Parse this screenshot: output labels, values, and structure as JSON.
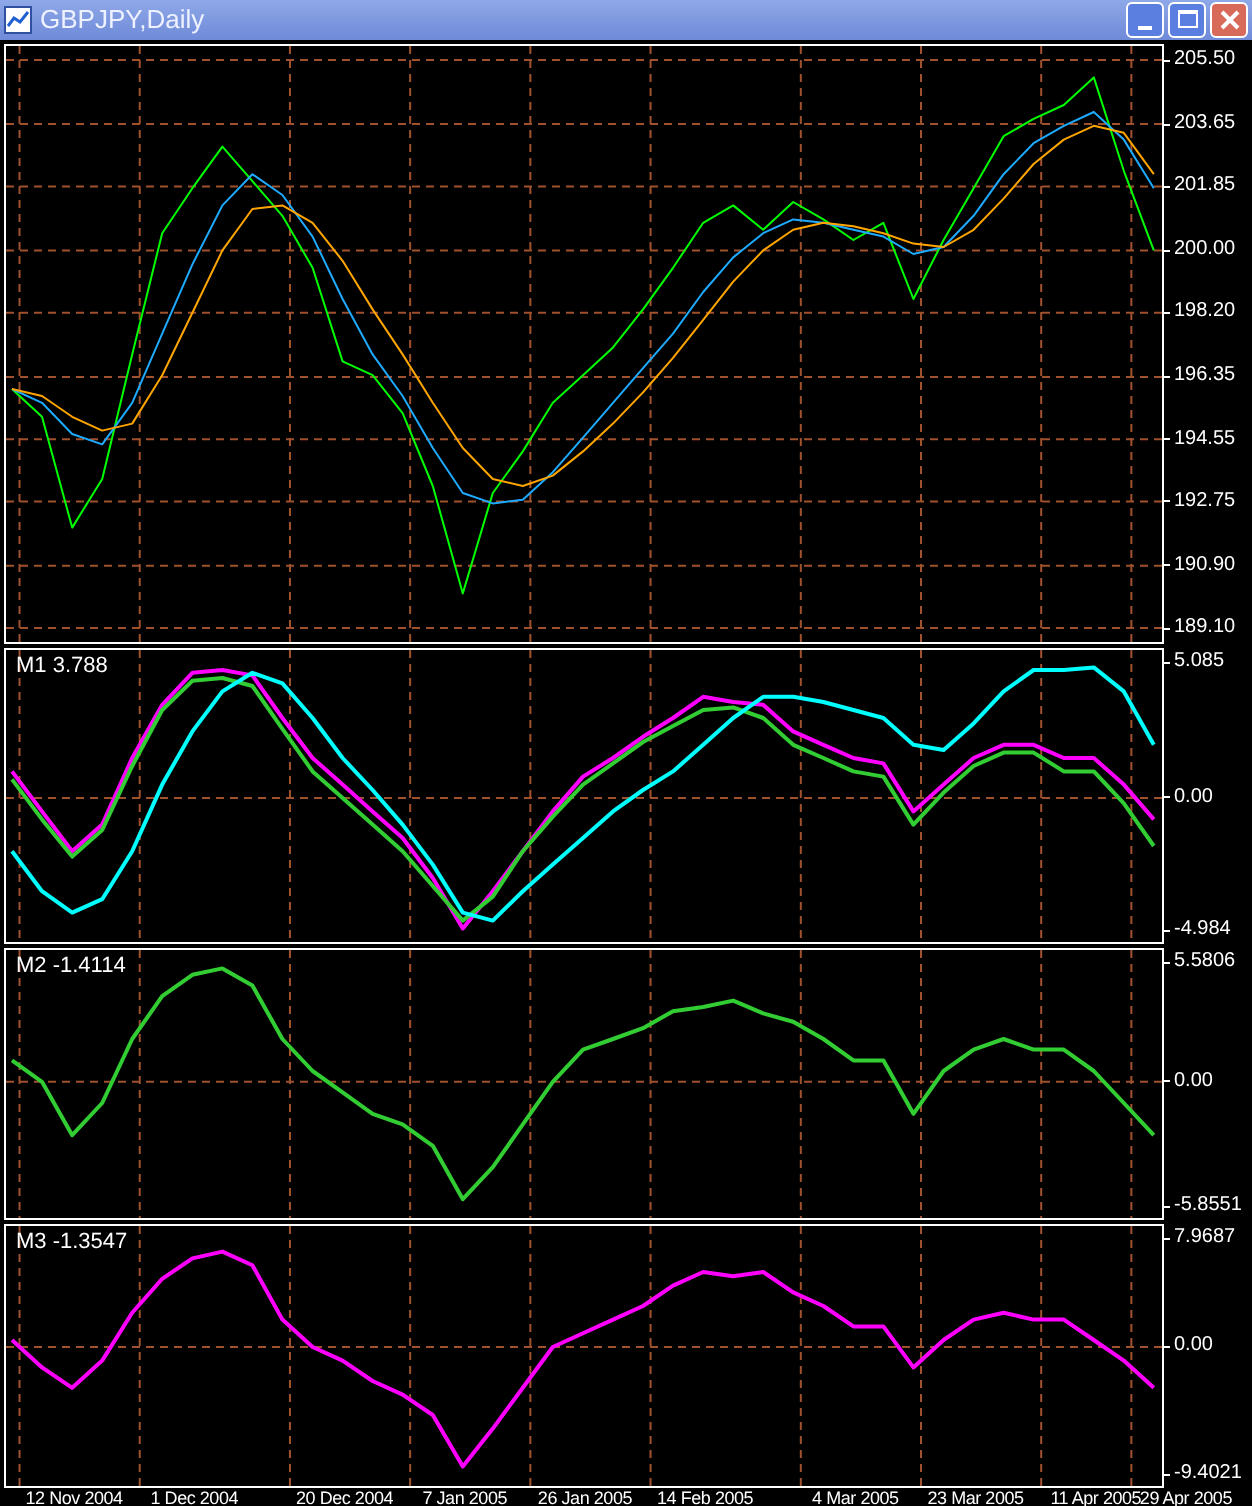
{
  "window": {
    "title": "GBPJPY,Daily"
  },
  "charts": [
    {
      "chart_data": {
        "type": "line",
        "grid": true,
        "ylim": [
          189.1,
          205.5
        ],
        "categories": [
          null,
          null,
          null,
          null,
          null,
          null,
          null,
          null,
          null,
          null,
          null,
          null,
          null,
          null,
          null,
          null,
          null,
          null,
          null,
          null,
          null,
          null,
          null,
          null,
          null,
          null,
          null,
          null,
          null,
          null,
          null,
          null,
          null,
          null,
          null,
          null,
          null,
          null,
          null,
          null,
          null
        ],
        "yticks": [
          {
            "value": 189.1,
            "label": "189.10"
          },
          {
            "value": 190.9,
            "label": "190.90"
          },
          {
            "value": 192.75,
            "label": "192.75"
          },
          {
            "value": 194.55,
            "label": "194.55"
          },
          {
            "value": 196.35,
            "label": "196.35"
          },
          {
            "value": 198.2,
            "label": "198.20"
          },
          {
            "value": 200,
            "label": "200.00"
          },
          {
            "value": 201.85,
            "label": "201.85"
          },
          {
            "value": 203.65,
            "label": "203.65"
          },
          {
            "value": 205.5,
            "label": "205.50"
          }
        ],
        "series": [
          {
            "color": "#00ff00",
            "values": [
              196.0,
              195.2,
              192.0,
              193.4,
              197.0,
              200.5,
              201.8,
              203.0,
              202.0,
              201.0,
              199.5,
              196.8,
              196.4,
              195.3,
              193.2,
              190.1,
              193.0,
              194.2,
              195.6,
              196.4,
              197.2,
              198.3,
              199.5,
              200.8,
              201.3,
              200.6,
              201.4,
              200.9,
              200.3,
              200.8,
              198.6,
              200.3,
              201.8,
              203.3,
              203.8,
              204.2,
              205.0,
              202.3,
              200.0,
              null,
              null
            ]
          },
          {
            "color": "#1eaaff",
            "values": [
              196.0,
              195.6,
              194.7,
              194.4,
              195.6,
              197.6,
              199.6,
              201.3,
              202.2,
              201.6,
              200.4,
              198.6,
              197.0,
              195.8,
              194.3,
              193.0,
              192.7,
              192.8,
              193.6,
              194.6,
              195.6,
              196.6,
              197.6,
              198.8,
              199.8,
              200.5,
              200.9,
              200.8,
              200.6,
              200.4,
              199.9,
              200.1,
              201.0,
              202.2,
              203.1,
              203.6,
              204.0,
              203.2,
              201.8,
              null,
              null
            ]
          },
          {
            "color": "#ffa500",
            "values": [
              196.0,
              195.8,
              195.2,
              194.8,
              195.0,
              196.4,
              198.2,
              200.0,
              201.2,
              201.3,
              200.8,
              199.7,
              198.3,
              197.0,
              195.6,
              194.3,
              193.4,
              193.2,
              193.5,
              194.2,
              195.0,
              195.9,
              196.9,
              198.0,
              199.1,
              200.0,
              200.6,
              200.8,
              200.7,
              200.5,
              200.2,
              200.1,
              200.6,
              201.5,
              202.5,
              203.2,
              203.6,
              203.4,
              202.2,
              null,
              null
            ]
          }
        ]
      }
    },
    {
      "chart_data": {
        "type": "line",
        "grid": true,
        "title": "M1 3.788",
        "ylim": [
          -5.404,
          5.554
        ],
        "ref_lines": [
          {
            "axis": "y",
            "value": 0
          }
        ],
        "categories": [
          null,
          null,
          null,
          null,
          null,
          null,
          null,
          null,
          null,
          null,
          null,
          null,
          null,
          null,
          null,
          null,
          null,
          null,
          null,
          null,
          null,
          null,
          null,
          null,
          null,
          null,
          null,
          null,
          null,
          null,
          null,
          null,
          null,
          null,
          null,
          null,
          null,
          null,
          null,
          null,
          null
        ],
        "yticks": [
          {
            "value": -4.984,
            "label": "-4.984"
          },
          {
            "value": 0,
            "label": "0.00"
          },
          {
            "value": 5.085,
            "label": "5.085"
          }
        ],
        "series": [
          {
            "color": "#ff00ff",
            "values": [
              1.0,
              -0.5,
              -2.0,
              -1.0,
              1.5,
              3.5,
              4.7,
              4.8,
              4.6,
              3.0,
              1.5,
              0.5,
              -0.5,
              -1.5,
              -3.0,
              -4.9,
              -3.5,
              -2.0,
              -0.5,
              0.8,
              1.5,
              2.3,
              3.0,
              3.8,
              3.6,
              3.5,
              2.5,
              2.0,
              1.5,
              1.3,
              -0.5,
              0.5,
              1.5,
              2.0,
              2.0,
              1.5,
              1.5,
              0.5,
              -0.8,
              null,
              null
            ]
          },
          {
            "color": "#32cd32",
            "values": [
              0.7,
              -0.8,
              -2.2,
              -1.2,
              1.2,
              3.3,
              4.4,
              4.5,
              4.2,
              2.6,
              1.0,
              0.0,
              -1.0,
              -2.0,
              -3.3,
              -4.6,
              -3.7,
              -2.0,
              -0.7,
              0.5,
              1.3,
              2.1,
              2.7,
              3.3,
              3.4,
              3.0,
              2.0,
              1.5,
              1.0,
              0.8,
              -1.0,
              0.2,
              1.2,
              1.7,
              1.7,
              1.0,
              1.0,
              -0.2,
              -1.8,
              null,
              null
            ]
          },
          {
            "color": "#00ffff",
            "values": [
              -2.0,
              -3.5,
              -4.3,
              -3.8,
              -2.0,
              0.5,
              2.5,
              4.0,
              4.7,
              4.3,
              3.0,
              1.5,
              0.3,
              -1.0,
              -2.5,
              -4.3,
              -4.6,
              -3.5,
              -2.5,
              -1.5,
              -0.5,
              0.3,
              1.0,
              2.0,
              3.0,
              3.8,
              3.8,
              3.6,
              3.3,
              3.0,
              2.0,
              1.8,
              2.8,
              4.0,
              4.8,
              4.8,
              4.9,
              4.0,
              2.0,
              null,
              null
            ]
          }
        ]
      }
    },
    {
      "chart_data": {
        "type": "line",
        "grid": true,
        "title": "M2 -1.4114",
        "ylim": [
          -6.377,
          6.164
        ],
        "ref_lines": [
          {
            "axis": "y",
            "value": 0
          }
        ],
        "categories": [
          null,
          null,
          null,
          null,
          null,
          null,
          null,
          null,
          null,
          null,
          null,
          null,
          null,
          null,
          null,
          null,
          null,
          null,
          null,
          null,
          null,
          null,
          null,
          null,
          null,
          null,
          null,
          null,
          null,
          null,
          null,
          null,
          null,
          null,
          null,
          null,
          null,
          null,
          null,
          null,
          null
        ],
        "yticks": [
          {
            "value": -5.8551,
            "label": "-5.8551"
          },
          {
            "value": 0,
            "label": "0.00"
          },
          {
            "value": 5.5806,
            "label": "5.5806"
          }
        ],
        "series": [
          {
            "color": "#32cd32",
            "values": [
              1.0,
              0.0,
              -2.5,
              -1.0,
              2.0,
              4.0,
              5.0,
              5.3,
              4.5,
              2.0,
              0.5,
              -0.5,
              -1.5,
              -2.0,
              -3.0,
              -5.5,
              -4.0,
              -2.0,
              0.0,
              1.5,
              2.0,
              2.5,
              3.3,
              3.5,
              3.8,
              3.2,
              2.8,
              2.0,
              1.0,
              1.0,
              -1.5,
              0.5,
              1.5,
              2.0,
              1.5,
              1.5,
              0.5,
              -1.0,
              -2.5,
              null,
              null
            ]
          }
        ]
      }
    },
    {
      "chart_data": {
        "type": "line",
        "grid": true,
        "title": "M3 -1.3547",
        "ylim": [
          -10.22,
          8.883
        ],
        "ref_lines": [
          {
            "axis": "y",
            "value": 0
          }
        ],
        "categories": [
          null,
          null,
          "12 Nov 2004",
          null,
          null,
          null,
          "1 Dec 2004",
          null,
          null,
          null,
          null,
          "20 Dec 2004",
          null,
          null,
          null,
          "7 Jan 2005",
          null,
          null,
          null,
          "26 Jan 2005",
          null,
          null,
          null,
          "14 Feb 2005",
          null,
          null,
          null,
          null,
          "4 Mar 2005",
          null,
          null,
          null,
          "23 Mar 2005",
          null,
          null,
          null,
          "11 Apr 2005",
          null,
          null,
          "29 Apr 2005",
          null
        ],
        "yticks": [
          {
            "value": -9.4021,
            "label": "-9.4021"
          },
          {
            "value": 0,
            "label": "0.00"
          },
          {
            "value": 7.9687,
            "label": "7.9687"
          }
        ],
        "series": [
          {
            "color": "#ff00ff",
            "values": [
              0.5,
              -1.5,
              -3.0,
              -1.0,
              2.5,
              5.0,
              6.5,
              7.0,
              6.0,
              2.0,
              0.0,
              -1.0,
              -2.5,
              -3.5,
              -5.0,
              -8.8,
              -6.0,
              -3.0,
              0.0,
              1.0,
              2.0,
              3.0,
              4.5,
              5.5,
              5.2,
              5.5,
              4.0,
              3.0,
              1.5,
              1.5,
              -1.5,
              0.5,
              2.0,
              2.5,
              2.0,
              2.0,
              0.5,
              -1.0,
              -3.0,
              null,
              null
            ]
          }
        ]
      }
    }
  ]
}
